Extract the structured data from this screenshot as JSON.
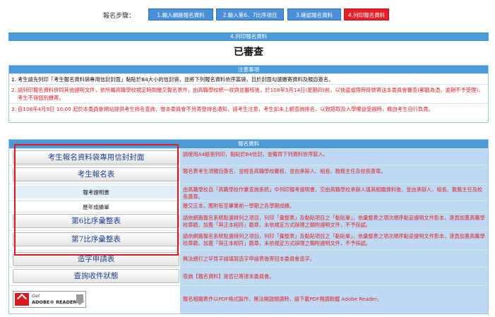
{
  "steps": {
    "label": "報名步驟：",
    "items": [
      {
        "label": "1.輸入網路報名資料"
      },
      {
        "label": "2.輸入第6、7比序項目"
      },
      {
        "label": "3.確認報名資料"
      },
      {
        "label": "4.列印報名資料"
      }
    ]
  },
  "section_title": "4.列印報名資料",
  "status": "已審查",
  "notices": {
    "heading": "注意事項",
    "items": [
      {
        "num": "1.",
        "text": "考生請先列印「考生報名資料袋專用信封封面」黏貼於B4大小的信封袋，並將下列報名資料依序裝袋，且於封面勾選繳寄資料及親自簽名。"
      },
      {
        "num": "2.",
        "text": "請列印報名資料併同其他證明文件，依所屬高職學校規定時間繳交報名表件，由高職學校統一收齊並審核後，於108年3月14日(星期四)前，以快遞或限時掛號寄送本委員會審查(郵戳為憑，逾期不予受理)，考生不得個別繳寄。"
      },
      {
        "num": "3.",
        "text": "自108年4月9日 10:00 起於本委員會網站提供考生排名查詢，惟本委員會不另寄發排名通知，請考生注意，考生如未上網查詢排名，以致錯取及入學權益受損時，概由考生自行負責。"
      }
    ]
  },
  "data_table": {
    "heading": "報名資料",
    "rows": [
      {
        "label": "考生報名資料袋專用信封封面",
        "desc": "請使用A4紙張列印，黏貼於B4信封，並備齊下列資料依序裝入。"
      },
      {
        "label": "考生報名表",
        "desc": "報名表考生須親自簽名，並經各高職學校審核，並由承辦人、組長、教務主任及校長簽章。"
      },
      {
        "label": "報考證明書",
        "desc": "由高職學校自「高職學校作業查詢系統」中列印報考證明書，交由高職學校承辦人填其相關資料後，並由承辦人、組長、教務主任及校長簽章。"
      },
      {
        "label": "歷年成績單",
        "desc": "繳交正本，應附有至畢業前一學期之各學期成績。"
      },
      {
        "label": "第6比序彙整表",
        "desc": "請依網路報名系統點選排列之項目，列印「彙整表」及黏貼項目之「黏貼單」，依彙整表之項次順序黏妥證明文件影本，逐頁加蓋高職學校章戳，加蓋「與正本相符」戳章，未依規定方式辦理之輸附證明文件，不予採認。"
      },
      {
        "label": "第7比序彙整表",
        "desc": "請依網路報名系統點選排列之項目，列印「彙整表」及黏貼項目之「黏貼單」，依彙整表之項次順序黏妥證明文件影本，逐頁加蓋高職學校章戳，加蓋「與正本相符」戳章，未依規定方式辦理之輸附證明文件，不予採認。"
      },
      {
        "label": "造字申請表",
        "desc": "無法繕打之罕見字請填寫造字申請表後寄回本委員會造字。"
      },
      {
        "label": "查詢收件狀態",
        "desc": "查詢【報名資料】是否已寄達本委員會。"
      },
      {
        "label": "Get ADOBE READER",
        "desc": "報名相關表件以PDF格式製作，無法開啟閱讀時，請下載PDF閱讀軟體 Adobe Reader。"
      }
    ]
  },
  "adobe": {
    "get": "Get",
    "text": "ADOBE® READER®"
  },
  "colors": {
    "accent": "#4a9ad9",
    "active_step": "#e4202a",
    "warning_text": "#e0232b",
    "highlight_frame": "#e2141c"
  }
}
